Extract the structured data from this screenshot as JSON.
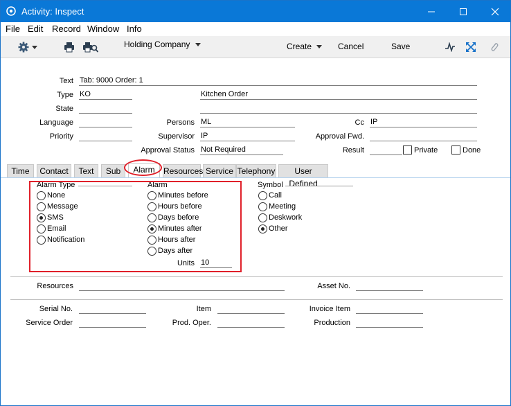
{
  "window": {
    "title": "Activity: Inspect",
    "title_bar_color": "#0a78d7"
  },
  "menu": [
    "File",
    "Edit",
    "Record",
    "Window",
    "Info"
  ],
  "toolbar": {
    "company": "Holding Company",
    "create": "Create",
    "cancel": "Cancel",
    "save": "Save"
  },
  "header": {
    "text_label": "Text",
    "text_value": "Tab: 9000 Order: 1",
    "type_label": "Type",
    "type_value": "KO",
    "type_desc": "Kitchen Order",
    "state_label": "State",
    "state_value": "",
    "language_label": "Language",
    "language_value": "",
    "persons_label": "Persons",
    "persons_value": "ML",
    "cc_label": "Cc",
    "cc_value": "IP",
    "priority_label": "Priority",
    "priority_value": "",
    "supervisor_label": "Supervisor",
    "supervisor_value": "IP",
    "approval_fwd_label": "Approval Fwd.",
    "approval_fwd_value": "",
    "approval_status_label": "Approval Status",
    "approval_status_value": "Not Required",
    "result_label": "Result",
    "result_value": "",
    "private_label": "Private",
    "done_label": "Done"
  },
  "tabs": [
    "Time",
    "Contact",
    "Text",
    "Sub",
    "Alarm",
    "Resources",
    "Service",
    "Telephony",
    "User Defined"
  ],
  "alarm_type": {
    "label": "Alarm Type",
    "options": [
      "None",
      "Message",
      "SMS",
      "Email",
      "Notification"
    ],
    "selected": "SMS"
  },
  "alarm": {
    "label": "Alarm",
    "options": [
      "Minutes before",
      "Hours before",
      "Days before",
      "Minutes after",
      "Hours after",
      "Days after"
    ],
    "selected": "Minutes after",
    "units_label": "Units",
    "units_value": "10"
  },
  "symbol": {
    "label": "Symbol",
    "options": [
      "Call",
      "Meeting",
      "Deskwork",
      "Other"
    ],
    "selected": "Other"
  },
  "lower": {
    "resources_label": "Resources",
    "resources_value": "",
    "asset_label": "Asset No.",
    "asset_value": "",
    "serial_label": "Serial No.",
    "serial_value": "",
    "item_label": "Item",
    "item_value": "",
    "invoice_item_label": "Invoice Item",
    "invoice_item_value": "",
    "service_order_label": "Service Order",
    "service_order_value": "",
    "prod_oper_label": "Prod. Oper.",
    "prod_oper_value": "",
    "production_label": "Production",
    "production_value": ""
  },
  "highlight_color": "#e0202a"
}
